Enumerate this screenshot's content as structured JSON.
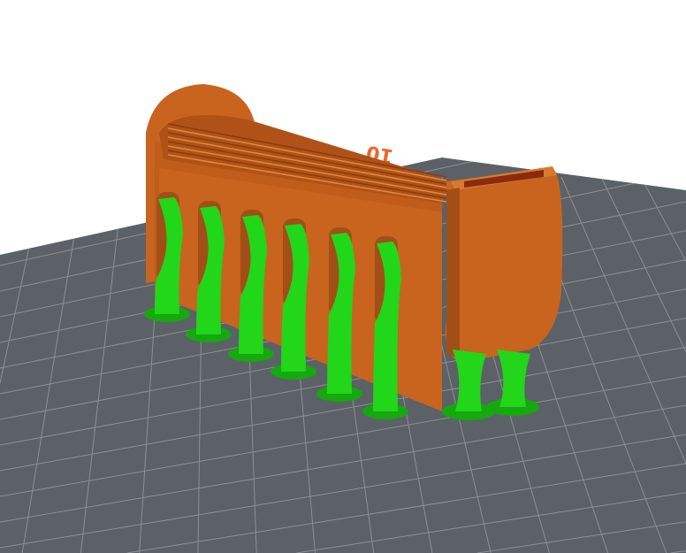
{
  "viewport": {
    "bed_label": "10",
    "colors": {
      "background": "#ffffff",
      "bed": "#5b6166",
      "bed_grid": "#8a9094",
      "model": "#c8641e",
      "model_dark": "#a24f17",
      "model_light": "#d9792e",
      "support": "#22d61a",
      "support_dark": "#15a80f",
      "label": "#f0642a"
    }
  }
}
